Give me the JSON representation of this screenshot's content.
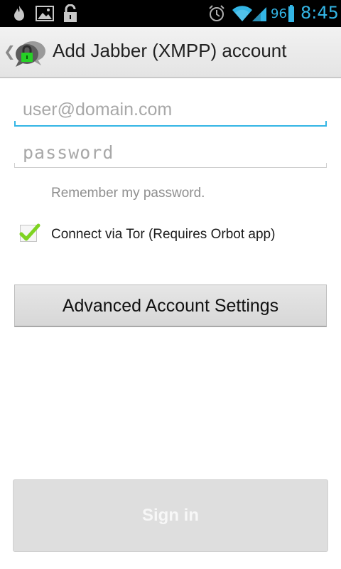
{
  "status_bar": {
    "icons": [
      "fire-icon",
      "image-icon",
      "unlock-icon",
      "alarm-icon",
      "wifi-icon",
      "signal-icon"
    ],
    "battery_level": "96",
    "time": "8:45",
    "accent_color": "#33b5e5"
  },
  "action_bar": {
    "up_glyph": "❮",
    "title": "Add Jabber (XMPP) account",
    "app_icon": "chat-bubble-lock-icon"
  },
  "form": {
    "username_placeholder": "user@domain.com",
    "username_value": "",
    "password_placeholder": "password",
    "password_value": "",
    "remember_label": "Remember my password.",
    "tor_label": "Connect via Tor (Requires Orbot app)",
    "tor_checked": true,
    "advanced_button_label": "Advanced Account Settings",
    "sign_in_label": "Sign in",
    "sign_in_enabled": false
  },
  "colors": {
    "focus_underline": "#33b5e5",
    "check_green": "#7ed321"
  }
}
